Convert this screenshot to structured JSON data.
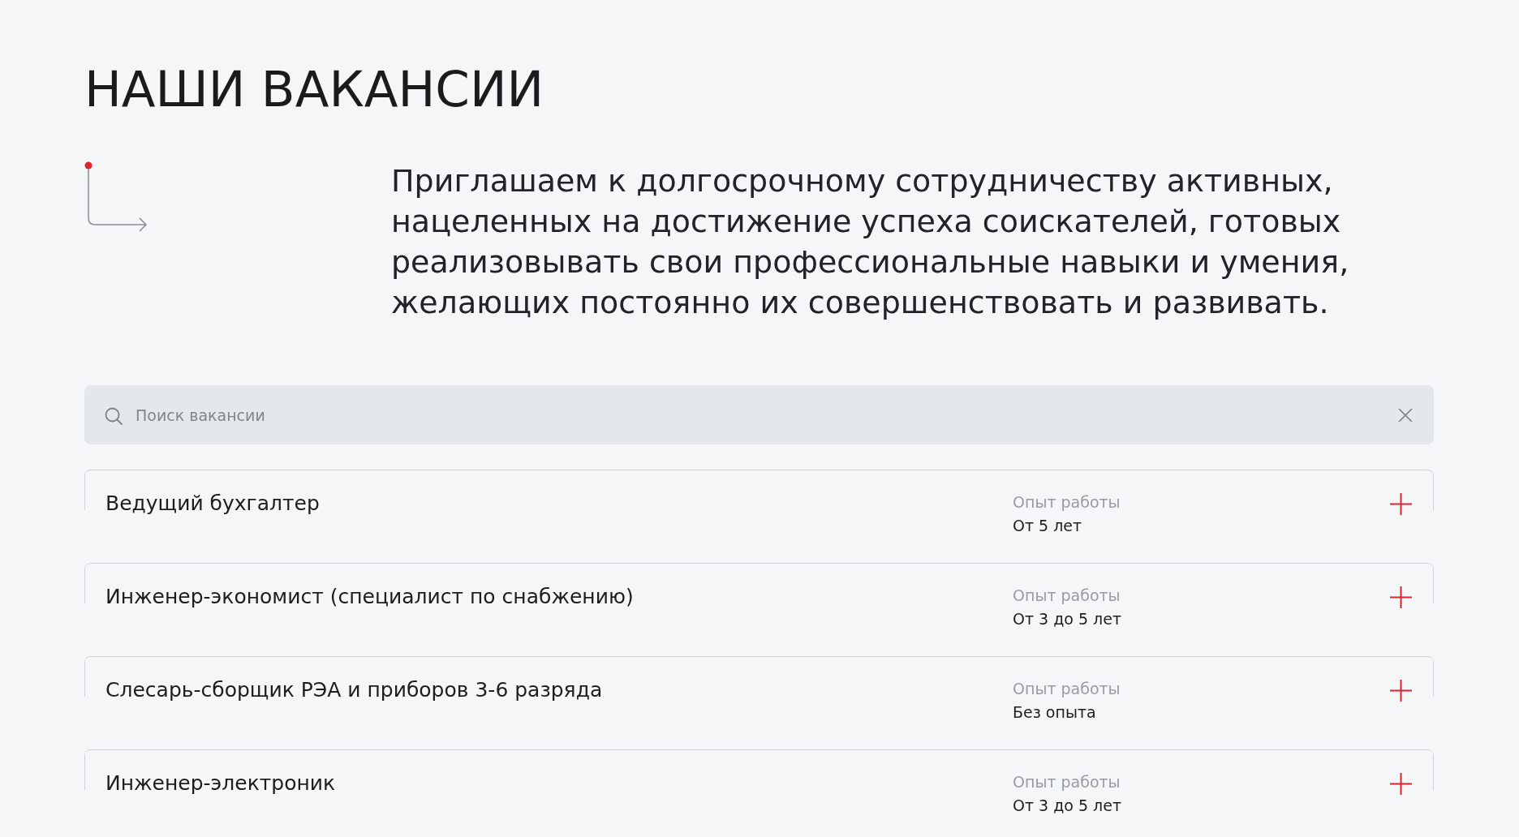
{
  "title": "НАШИ ВАКАНСИИ",
  "intro": "Приглашаем к долгосрочному сотрудничеству активных, нацеленных на достижение успеха соискателей, готовых реализовывать свои профессиональные навыки и умения, желающих постоянно их совершенствовать и развивать.",
  "search": {
    "placeholder": "Поиск вакансии"
  },
  "vacancies": [
    {
      "title": "Ведущий бухгалтер",
      "experience_label": "Опыт работы",
      "experience": "От 5 лет",
      "expanded": false
    },
    {
      "title": "Инженер-экономист (специалист по снабжению)",
      "experience_label": "Опыт работы",
      "experience": "От 3 до 5 лет",
      "expanded": false
    },
    {
      "title": "Слесарь-сборщик РЭА и приборов 3-6 разряда",
      "experience_label": "Опыт работы",
      "experience": "Без опыта",
      "expanded": false
    },
    {
      "title": "Инженер-электроник",
      "experience_label": "Опыт работы",
      "experience": "От 3 до 5 лет",
      "expanded": false
    }
  ]
}
